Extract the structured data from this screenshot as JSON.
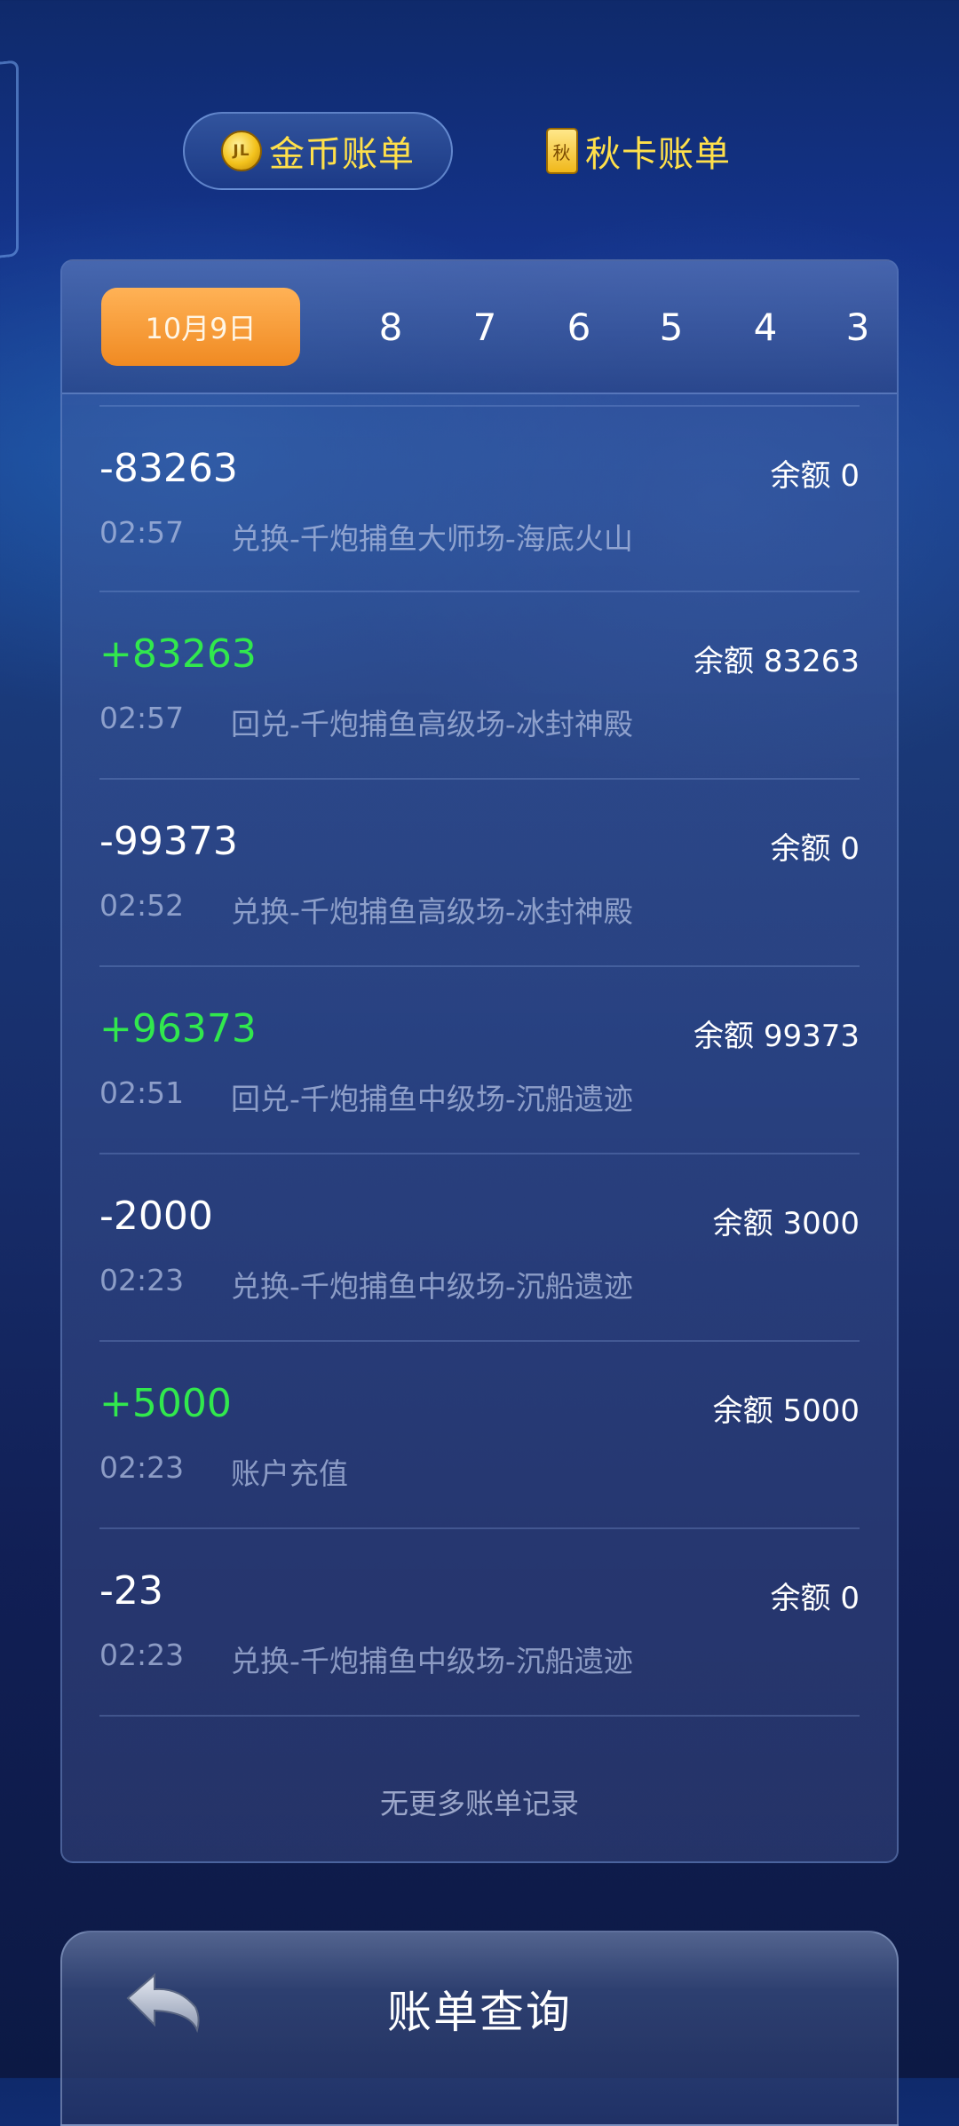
{
  "tabs": {
    "gold_label": "金币账单",
    "card_label": "秋卡账单",
    "coin_icon_text": "JL",
    "card_icon_text": "秋"
  },
  "dates": [
    "10月9日",
    "8",
    "7",
    "6",
    "5",
    "4",
    "3"
  ],
  "records": [
    {
      "amount": "-83263",
      "balance": "余额 0",
      "time": "02:57",
      "desc": "兑换-千炮捕鱼大师场-海底火山"
    },
    {
      "amount": "+83263",
      "balance": "余额 83263",
      "time": "02:57",
      "desc": "回兑-千炮捕鱼高级场-冰封神殿"
    },
    {
      "amount": "-99373",
      "balance": "余额 0",
      "time": "02:52",
      "desc": "兑换-千炮捕鱼高级场-冰封神殿"
    },
    {
      "amount": "+96373",
      "balance": "余额 99373",
      "time": "02:51",
      "desc": "回兑-千炮捕鱼中级场-沉船遗迹"
    },
    {
      "amount": "-2000",
      "balance": "余额 3000",
      "time": "02:23",
      "desc": "兑换-千炮捕鱼中级场-沉船遗迹"
    },
    {
      "amount": "+5000",
      "balance": "余额 5000",
      "time": "02:23",
      "desc": "账户充值"
    },
    {
      "amount": "-23",
      "balance": "余额 0",
      "time": "02:23",
      "desc": "兑换-千炮捕鱼中级场-沉船遗迹"
    }
  ],
  "no_more_text": "无更多账单记录",
  "bottom": {
    "title": "账单查询",
    "back_icon": "back-arrow-icon"
  },
  "colors": {
    "accent_yellow": "#ffe04a",
    "positive_green": "#31e84d",
    "active_date_orange": "#f5972e"
  }
}
